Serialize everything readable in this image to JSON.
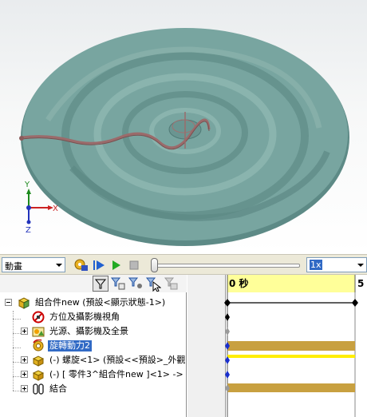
{
  "viewport": {
    "triad": {
      "x_label": "X",
      "y_label": "Y",
      "z_label": "Z"
    },
    "colors": {
      "part": "#6f9b97",
      "part_dark": "#5a8782",
      "x_axis": "#cc2222",
      "y_axis": "#1d8a1d",
      "z_axis": "#2233bb"
    }
  },
  "toolbar": {
    "study_type": "動畫",
    "speed": "1x",
    "buttons": [
      "calculate-icon",
      "play-from-start-icon",
      "play-icon",
      "stop-icon"
    ]
  },
  "tree": {
    "filters": [
      "filter-animated-icon",
      "filter-driving-icon",
      "filter-selected-icon",
      "filter-results-icon",
      "autokey-icon"
    ],
    "items": [
      {
        "label": "組合件new  (預設<顯示狀態-1>)",
        "icon": "assembly-icon",
        "expander": "minus"
      },
      {
        "label": "方位及攝影機視角",
        "icon": "orientation-camera-icon",
        "expander": ""
      },
      {
        "label": "光源、攝影機及全景",
        "icon": "lights-cameras-icon",
        "expander": "plus"
      },
      {
        "label": "旋轉動力2",
        "icon": "rotary-motor-icon",
        "expander": "",
        "selected": true
      },
      {
        "label": "(-) 螺旋<1> (預設<<預設>_外觀",
        "icon": "part-icon",
        "expander": "plus"
      },
      {
        "label": "(-) [ 零件3^組合件new ]<1> ->",
        "icon": "part-icon",
        "expander": "plus"
      },
      {
        "label": "結合",
        "icon": "mates-icon",
        "expander": "plus"
      }
    ]
  },
  "timeline": {
    "start_label": "0 秒",
    "end_label": "5",
    "colors": {
      "highlight": "#ffff99",
      "bar": "#c8a040",
      "marker": "#ffee00",
      "key_blue": "#1a2fcc"
    }
  }
}
